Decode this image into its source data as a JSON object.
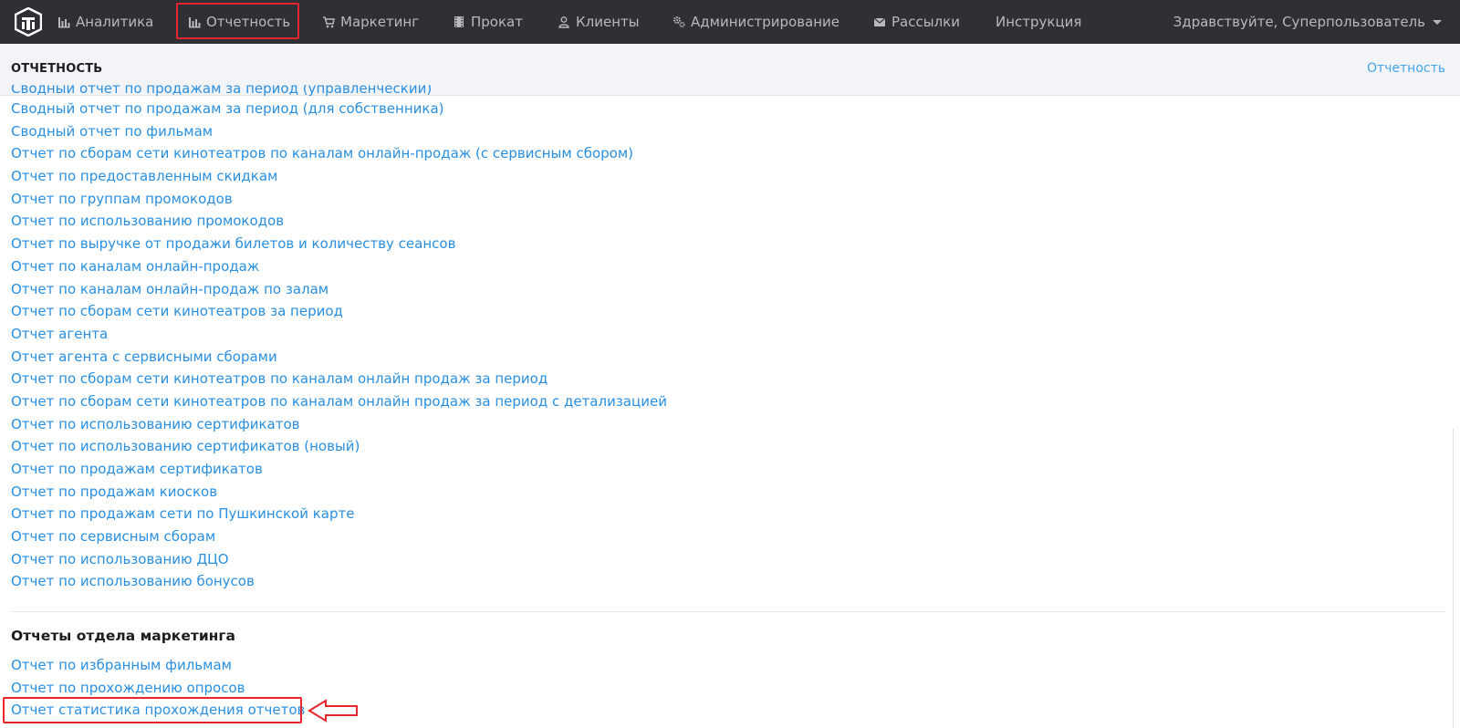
{
  "nav": {
    "items": [
      {
        "label": "Аналитика",
        "icon": "bar-chart-icon"
      },
      {
        "label": "Отчетность",
        "icon": "bar-chart-icon"
      },
      {
        "label": "Маркетинг",
        "icon": "cart-icon"
      },
      {
        "label": "Прокат",
        "icon": "film-icon"
      },
      {
        "label": "Клиенты",
        "icon": "user-icon"
      },
      {
        "label": "Администрирование",
        "icon": "gears-icon"
      },
      {
        "label": "Рассылки",
        "icon": "envelope-icon"
      },
      {
        "label": "Инструкция",
        "icon": ""
      }
    ],
    "active": "Отчетность",
    "user_greeting": "Здравствуйте, Суперпользователь"
  },
  "header": {
    "title": "ОТЧЕТНОСТЬ",
    "breadcrumb": "Отчетность"
  },
  "reports": {
    "cut_off_item": "Сводный отчет по продажам за период (управленческий)",
    "items": [
      "Сводный отчет по продажам за период (для собственника)",
      "Сводный отчет по фильмам",
      "Отчет по сборам сети кинотеатров по каналам онлайн-продаж (с сервисным сбором)",
      "Отчет по предоставленным скидкам",
      "Отчет по группам промокодов",
      "Отчет по использованию промокодов",
      "Отчет по выручке от продажи билетов и количеству сеансов",
      "Отчет по каналам онлайн-продаж",
      "Отчет по каналам онлайн-продаж по залам",
      "Отчет по сборам сети кинотеатров за период",
      "Отчет агента",
      "Отчет агента с сервисными сборами",
      "Отчет по сборам сети кинотеатров по каналам онлайн продаж за период",
      "Отчет по сборам сети кинотеатров по каналам онлайн продаж за период с детализацией",
      "Отчет по использованию сертификатов",
      "Отчет по использованию сертификатов (новый)",
      "Отчет по продажам сертификатов",
      "Отчет по продажам киосков",
      "Отчет по продажам сети по Пушкинской карте",
      "Отчет по сервисным сборам",
      "Отчет по использованию ДЦО",
      "Отчет по использованию бонусов"
    ]
  },
  "marketing": {
    "title": "Отчеты отдела маркетинга",
    "items": [
      "Отчет по избранным фильмам",
      "Отчет по прохождению опросов",
      "Отчет статистика прохождения отчетов"
    ]
  },
  "colors": {
    "nav_bg": "#2f3035",
    "link": "#2a8fe0",
    "highlight": "#e8242c"
  }
}
